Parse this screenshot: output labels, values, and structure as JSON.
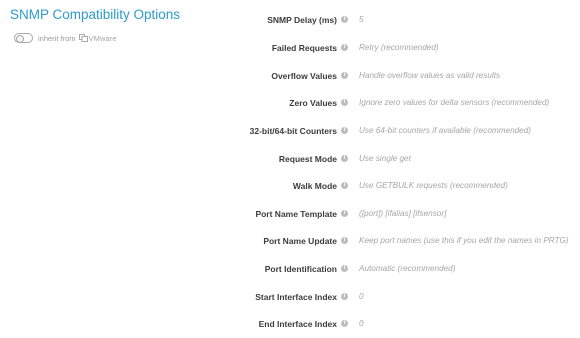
{
  "section": {
    "title": "SNMP Compatibility Options",
    "inherit_text": "inherit from",
    "inherit_source": "VMware",
    "inherit_icon": "vmware-logo-icon"
  },
  "colors": {
    "title": "#2f9bc9",
    "label": "#3c3c3c",
    "value": "#a6a6a6",
    "info_icon": "#bdbdbd"
  },
  "settings": [
    {
      "label": "SNMP Delay (ms)",
      "value": "5"
    },
    {
      "label": "Failed Requests",
      "value": "Retry (recommended)"
    },
    {
      "label": "Overflow Values",
      "value": "Handle overflow values as valid results"
    },
    {
      "label": "Zero Values",
      "value": "Ignore zero values for delta sensors (recommended)"
    },
    {
      "label": "32-bit/64-bit Counters",
      "value": "Use 64-bit counters if available (recommended)"
    },
    {
      "label": "Request Mode",
      "value": "Use single get"
    },
    {
      "label": "Walk Mode",
      "value": "Use GETBULK requests (recommended)"
    },
    {
      "label": "Port Name Template",
      "value": "([port]) [ifalias] [ifsensor]"
    },
    {
      "label": "Port Name Update",
      "value": "Keep port names (use this if you edit the names in PRTG)"
    },
    {
      "label": "Port Identification",
      "value": "Automatic (recommended)"
    },
    {
      "label": "Start Interface Index",
      "value": "0"
    },
    {
      "label": "End Interface Index",
      "value": "0"
    }
  ]
}
